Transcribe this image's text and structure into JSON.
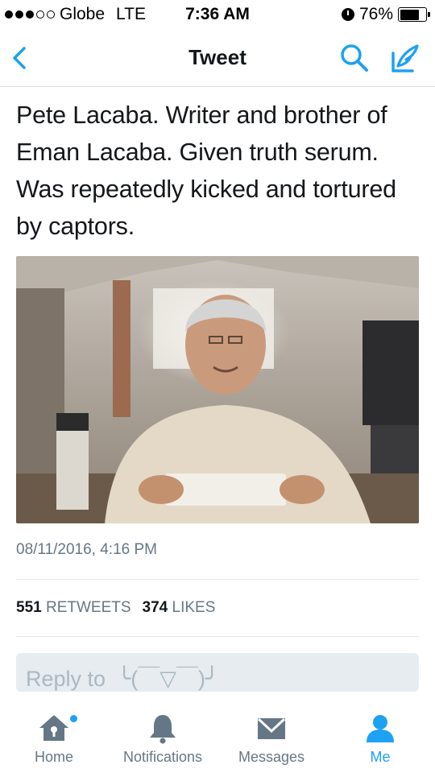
{
  "status_bar": {
    "carrier": "Globe",
    "network": "LTE",
    "time": "7:36 AM",
    "battery": "76%",
    "battery_level": 0.76
  },
  "nav": {
    "title": "Tweet",
    "back_icon": "chevron-left-icon",
    "search_icon": "search-icon",
    "compose_icon": "compose-icon"
  },
  "tweet": {
    "text": "Pete Lacaba. Writer and brother of Eman Lacaba. Given truth serum. Was repeatedly kicked and tortured by captors.",
    "timestamp": "08/11/2016, 4:16 PM",
    "retweet_count": "551",
    "retweet_label": "RETWEETS",
    "like_count": "374",
    "like_label": "LIKES",
    "photo_alt": "photo of a man seated at a desk"
  },
  "reply": {
    "placeholder": "Reply to  ╰(￣▽￣)╯"
  },
  "tab_bar": {
    "tabs": [
      {
        "label": "Home",
        "icon": "home-icon"
      },
      {
        "label": "Notifications",
        "icon": "bell-icon"
      },
      {
        "label": "Messages",
        "icon": "envelope-icon"
      },
      {
        "label": "Me",
        "icon": "person-icon"
      }
    ],
    "active": "Me"
  },
  "colors": {
    "accent": "#1da1f2",
    "text": "#14171a",
    "secondary": "#657786",
    "reply_bg": "#e6ecf0"
  }
}
